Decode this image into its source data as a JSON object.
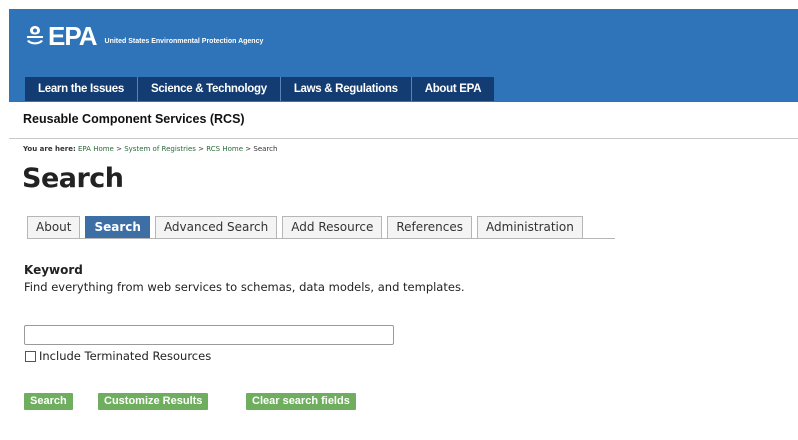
{
  "header": {
    "logo_text": "EPA",
    "agency_name": "United States Environmental Protection Agency",
    "logo_icon": "epa-flower-icon",
    "colors": {
      "header_blue": "#2f73b8",
      "nav_navy": "#123c72",
      "button_green": "#6fae5f",
      "tab_active": "#3d6fa4"
    }
  },
  "topnav": {
    "items": [
      {
        "label": "Learn the Issues"
      },
      {
        "label": "Science & Technology"
      },
      {
        "label": "Laws & Regulations"
      },
      {
        "label": "About EPA"
      }
    ]
  },
  "program": {
    "title": "Reusable Component Services (RCS)"
  },
  "breadcrumb": {
    "prefix": "You are here:",
    "links": [
      "EPA Home",
      "System of Registries",
      "RCS Home"
    ],
    "separator": ">",
    "current": "Search"
  },
  "page": {
    "title": "Search"
  },
  "tabs": [
    {
      "label": "About",
      "active": false
    },
    {
      "label": "Search",
      "active": true
    },
    {
      "label": "Advanced Search",
      "active": false
    },
    {
      "label": "Add Resource",
      "active": false
    },
    {
      "label": "References",
      "active": false
    },
    {
      "label": "Administration",
      "active": false
    }
  ],
  "keyword": {
    "label": "Keyword",
    "description": "Find everything from web services to schemas, data models, and templates.",
    "input_value": "",
    "checkbox_label": "Include Terminated Resources",
    "checkbox_checked": false
  },
  "buttons": {
    "search": "Search",
    "customize": "Customize Results",
    "clear": "Clear search fields"
  }
}
